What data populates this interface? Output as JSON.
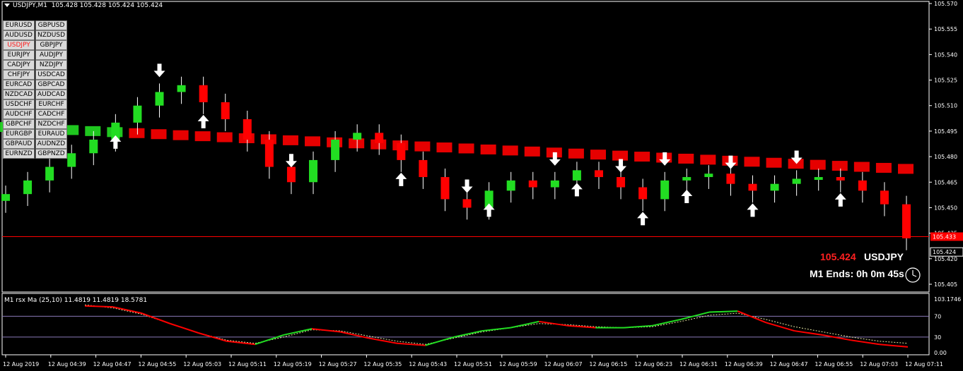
{
  "header": {
    "symbol_tf": "USDJPY,M1",
    "ohlc": "105.428 105.428 105.424 105.424"
  },
  "indicator": {
    "label": "M1 rsx Ma (25,10) 11.4819 11.4819 18.5781"
  },
  "pairs": [
    "EURUSD",
    "GBPUSD",
    "AUDUSD",
    "NZDUSD",
    "USDJPY",
    "GBPJPY",
    "EURJPY",
    "AUDJPY",
    "CADJPY",
    "NZDJPY",
    "CHFJPY",
    "USDCAD",
    "EURCAD",
    "GBPCAD",
    "NZDCAD",
    "AUDCAD",
    "USDCHF",
    "EURCHF",
    "AUDCHF",
    "CADCHF",
    "GBPCHF",
    "NZDCHF",
    "EURGBP",
    "EURAUD",
    "GBPAUD",
    "AUDNZD",
    "EURNZD",
    "GBPNZD"
  ],
  "active_pair": "USDJPY",
  "info": {
    "last_price": "105.424",
    "symbol": "USDJPY",
    "timer": "M1 Ends: 0h 0m 45s"
  },
  "price_axis": {
    "labels": [
      "105.570",
      "105.555",
      "105.540",
      "105.525",
      "105.510",
      "105.495",
      "105.480",
      "105.465",
      "105.450",
      "105.435",
      "105.420",
      "105.405"
    ],
    "min": 105.405,
    "max": 105.57,
    "hline_label": "105.433",
    "hline_value": 105.433,
    "current_label": "105.424",
    "current_value": 105.424
  },
  "sub_axis": {
    "labels": [
      "103.1746",
      "70",
      "30",
      "0.00"
    ],
    "levels": [
      70,
      30
    ],
    "max": 103.1746,
    "min": 0
  },
  "time_axis": {
    "labels": [
      "12 Aug 2019",
      "12 Aug 04:39",
      "12 Aug 04:47",
      "12 Aug 04:55",
      "12 Aug 05:03",
      "12 Aug 05:11",
      "12 Aug 05:19",
      "12 Aug 05:27",
      "12 Aug 05:35",
      "12 Aug 05:43",
      "12 Aug 05:51",
      "12 Aug 05:59",
      "12 Aug 06:07",
      "12 Aug 06:15",
      "12 Aug 06:23",
      "12 Aug 06:31",
      "12 Aug 06:39",
      "12 Aug 06:47",
      "12 Aug 06:55",
      "12 Aug 07:03",
      "12 Aug 07:11"
    ]
  },
  "colors": {
    "bull": "#22dd22",
    "bear": "#ff0000",
    "axis": "#ffffff",
    "hline": "#ff0000",
    "level": "#8a7ab8",
    "signal": "#e6e6a0"
  },
  "chart_data": {
    "type": "line",
    "series": [
      {
        "name": "USDJPY",
        "values": [
          105.458,
          105.466,
          105.474,
          105.482,
          105.49,
          105.5,
          105.51,
          105.518,
          105.522,
          105.512,
          105.502,
          105.49,
          105.474,
          105.465,
          105.478,
          105.49,
          105.494,
          105.488,
          105.478,
          105.468,
          105.455,
          105.45,
          105.46,
          105.466,
          105.462,
          105.466,
          105.472,
          105.468,
          105.462,
          105.455,
          105.466,
          105.468,
          105.47,
          105.464,
          105.46,
          105.464,
          105.467,
          105.468,
          105.466,
          105.46,
          105.452,
          105.432
        ]
      },
      {
        "name": "rsx",
        "values": [
          90,
          88,
          76,
          56,
          38,
          22,
          16,
          34,
          46,
          40,
          28,
          18,
          14,
          30,
          42,
          48,
          60,
          52,
          48,
          48,
          52,
          64,
          78,
          80,
          58,
          42,
          34,
          24,
          16,
          11
        ]
      },
      {
        "name": "ma",
        "values": [
          92,
          86,
          74,
          56,
          38,
          24,
          18,
          30,
          44,
          42,
          32,
          22,
          16,
          28,
          40,
          48,
          56,
          54,
          50,
          48,
          50,
          60,
          72,
          76,
          64,
          50,
          40,
          30,
          22,
          18
        ]
      }
    ],
    "arrows_up": [
      5,
      9,
      18,
      22,
      26,
      29,
      31,
      34,
      38
    ],
    "arrows_down": [
      7,
      13,
      21,
      25,
      28,
      30,
      33,
      36
    ],
    "ylim": [
      105.405,
      105.57
    ]
  }
}
